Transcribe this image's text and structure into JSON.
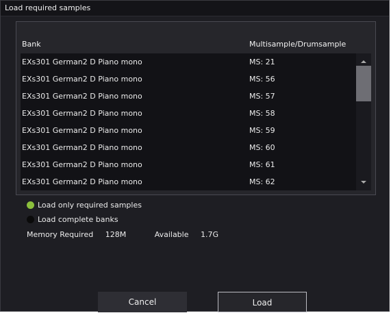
{
  "dialog": {
    "title": "Load required samples"
  },
  "list": {
    "headers": {
      "bank": "Bank",
      "sample": "Multisample/Drumsample"
    },
    "rows": [
      {
        "bank": "EXs301 German2 D Piano mono",
        "sample": "MS: 21"
      },
      {
        "bank": "EXs301 German2 D Piano mono",
        "sample": "MS: 56"
      },
      {
        "bank": "EXs301 German2 D Piano mono",
        "sample": "MS: 57"
      },
      {
        "bank": "EXs301 German2 D Piano mono",
        "sample": "MS: 58"
      },
      {
        "bank": "EXs301 German2 D Piano mono",
        "sample": "MS: 59"
      },
      {
        "bank": "EXs301 German2 D Piano mono",
        "sample": "MS: 60"
      },
      {
        "bank": "EXs301 German2 D Piano mono",
        "sample": "MS: 61"
      },
      {
        "bank": "EXs301 German2 D Piano mono",
        "sample": "MS: 62"
      }
    ]
  },
  "options": {
    "load_required": {
      "label": "Load only required samples",
      "selected": true,
      "color": "#8bbf3c"
    },
    "load_complete": {
      "label": "Load complete banks",
      "selected": false,
      "color": "#0a0a0a"
    }
  },
  "memory": {
    "required_label": "Memory Required",
    "required_value": "128M",
    "available_label": "Available",
    "available_value": "1.7G"
  },
  "buttons": {
    "cancel": "Cancel",
    "load": "Load"
  }
}
